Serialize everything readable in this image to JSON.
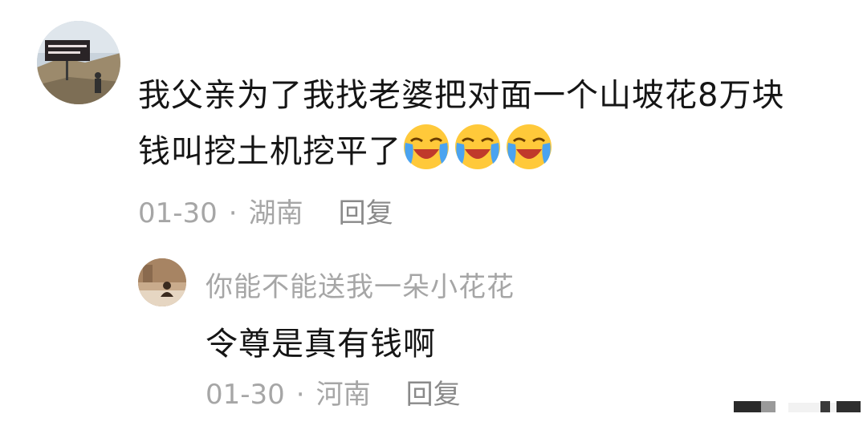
{
  "comment": {
    "avatar_icon": "user-avatar-photo-icon",
    "text_line1": "我父亲为了我找老婆把对面一个山坡花8万块",
    "text_line2": "钱叫挖土机挖平了",
    "emoji_name": "laughing-crying-emoji",
    "emoji_count": 3,
    "date": "01-30",
    "separator": "·",
    "location": "湖南",
    "reply_label": "回复"
  },
  "reply": {
    "avatar_icon": "user-avatar-photo-icon",
    "username": "你能不能送我一朵小花花",
    "text": "令尊是真有钱啊",
    "date": "01-30",
    "separator": "·",
    "location": "河南",
    "reply_label": "回复"
  },
  "colors": {
    "primary_text": "#151515",
    "secondary_text": "#a6a6a6",
    "background": "#ffffff"
  }
}
